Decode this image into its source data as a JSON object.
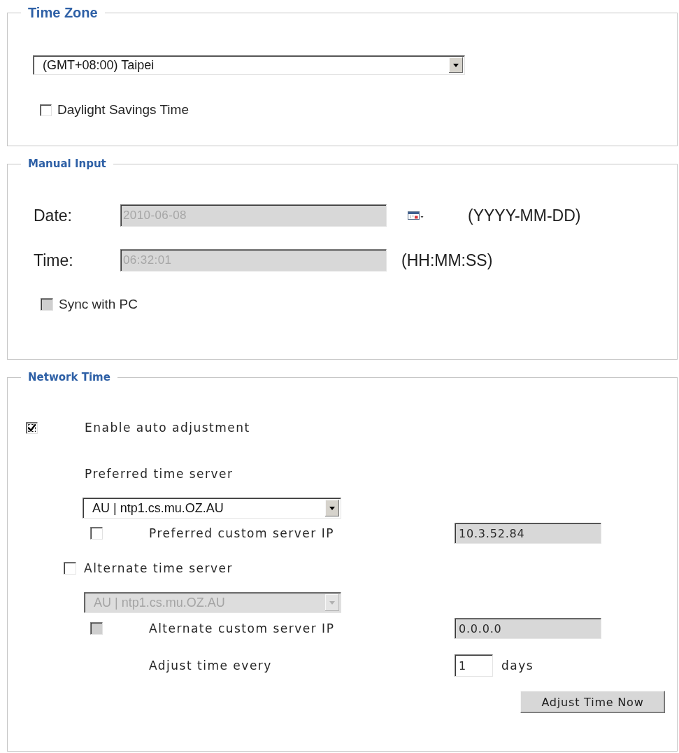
{
  "time_zone": {
    "legend": "Time Zone",
    "timezone": {
      "value": "(GMT+08:00) Taipei",
      "disabled": false
    },
    "daylight_savings": {
      "label": "Daylight Savings Time",
      "checked": false,
      "disabled": false
    }
  },
  "manual_input": {
    "legend": "Manual Input",
    "fields": [
      {
        "label": "Date:",
        "value": "2010-06-08",
        "disabled": true,
        "picker": true,
        "format": "(YYYY-MM-DD)"
      },
      {
        "label": "Time:",
        "value": "06:32:01",
        "disabled": true,
        "picker": false,
        "format": "(HH:MM:SS)"
      }
    ],
    "sync_with_pc": {
      "label": "Sync with PC",
      "checked": false,
      "disabled": true
    }
  },
  "network_time": {
    "legend": "Network Time",
    "enable_auto_adjustment": {
      "label": "Enable auto adjustment",
      "checked": true,
      "focused": true
    },
    "preferred_time_server": {
      "label": "Preferred time server",
      "value": "AU | ntp1.cs.mu.OZ.AU",
      "disabled": false
    },
    "preferred_custom_ip": {
      "label": "Preferred custom server IP",
      "checked": false,
      "disabled": false,
      "value": "10.3.52.84",
      "readonly": true
    },
    "alternate_time_server": {
      "label": "Alternate time server",
      "checked": false,
      "disabled": false
    },
    "alternate_server_select": {
      "value": "AU | ntp1.cs.mu.OZ.AU",
      "disabled": true
    },
    "alternate_custom_ip": {
      "label": "Alternate custom server IP",
      "checked": false,
      "disabled": true,
      "value": "0.0.0.0",
      "readonly": true
    },
    "adjust_interval": {
      "label": "Adjust time every",
      "value": "1",
      "unit": "days"
    },
    "adjust_button": "Adjust Time Now"
  }
}
